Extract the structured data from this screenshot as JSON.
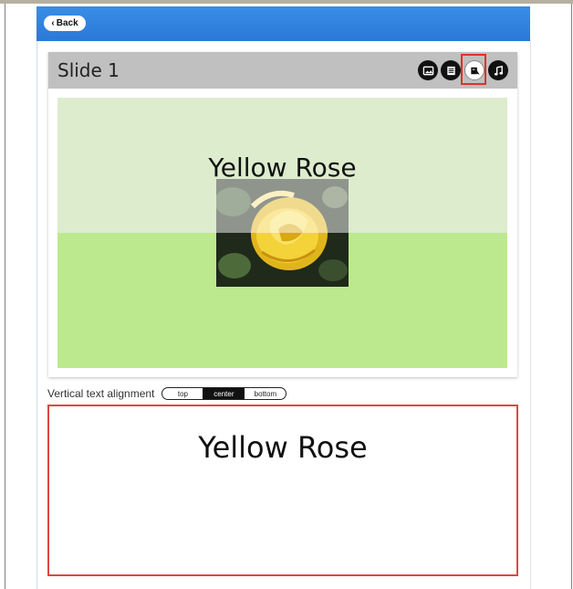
{
  "header": {
    "back_label": "Back"
  },
  "slide": {
    "title": "Slide 1",
    "toolbar_icons": [
      "image-icon",
      "text-list-icon",
      "text-style-icon",
      "music-note-icon"
    ],
    "selected_icon": "text-style-icon",
    "canvas_text": "Yellow Rose",
    "colors": {
      "top_band": "#ddeccd",
      "bottom_band": "#bce98e"
    }
  },
  "alignment": {
    "label": "Vertical text alignment",
    "options": [
      "top",
      "center",
      "bottom"
    ],
    "selected": "center"
  },
  "preview": {
    "text": "Yellow Rose"
  }
}
